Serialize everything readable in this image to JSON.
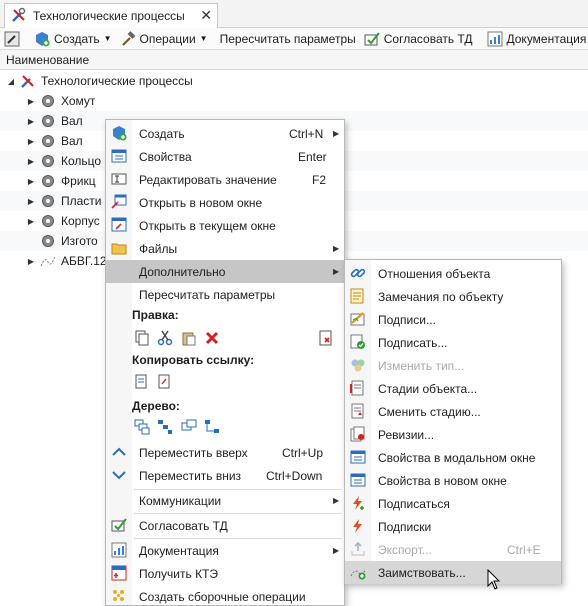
{
  "tab": {
    "title": "Технологические процессы",
    "close": "✕"
  },
  "toolbar": {
    "create": "Создать",
    "operations": "Операции",
    "recalc": "Пересчитать параметры",
    "approve_td": "Согласовать ТД",
    "documentation": "Документация"
  },
  "column_header": "Наименование",
  "tree": {
    "root": "Технологические процессы",
    "items": [
      "Хомут",
      "Вал",
      "Вал",
      "Кольцо",
      "Фрикц",
      "Пласти",
      "Корпус",
      "Изгото",
      "АБВГ.12"
    ]
  },
  "context_menu": {
    "items": [
      {
        "label": "Создать",
        "shortcut": "Ctrl+N",
        "submenu": true
      },
      {
        "label": "Свойства",
        "shortcut": "Enter"
      },
      {
        "label": "Редактировать значение",
        "shortcut": "F2"
      },
      {
        "label": "Открыть в новом окне"
      },
      {
        "label": "Открыть в текущем окне"
      },
      {
        "label": "Файлы",
        "submenu": true
      },
      {
        "label": "Дополнительно",
        "submenu": true
      },
      {
        "label": "Пересчитать параметры"
      }
    ],
    "section_edit": "Правка:",
    "section_copy_link": "Копировать ссылку:",
    "section_tree": "Дерево:",
    "move_up": {
      "label": "Переместить вверх",
      "shortcut": "Ctrl+Up"
    },
    "move_down": {
      "label": "Переместить вниз",
      "shortcut": "Ctrl+Down"
    },
    "communications": "Коммуникации",
    "approve_td": "Согласовать ТД",
    "documentation": "Документация",
    "get_kte": "Получить КТЭ",
    "create_assembly": "Создать сборочные операции"
  },
  "submenu": {
    "items": [
      {
        "label": "Отношения объекта"
      },
      {
        "label": "Замечания по объекту"
      },
      {
        "label": "Подписи..."
      },
      {
        "label": "Подписать..."
      },
      {
        "label": "Изменить тип...",
        "disabled": true
      },
      {
        "label": "Стадии объекта..."
      },
      {
        "label": "Сменить стадию..."
      },
      {
        "label": "Ревизии..."
      },
      {
        "label": "Свойства в модальном окне"
      },
      {
        "label": "Свойства в новом окне"
      },
      {
        "label": "Подписаться"
      },
      {
        "label": "Подписки"
      },
      {
        "label": "Экспорт...",
        "shortcut": "Ctrl+E",
        "disabled": true
      },
      {
        "label": "Заимствовать..."
      }
    ]
  },
  "colors": {
    "highlight": "#c6c6c6",
    "accent_blue": "#2a6ebb",
    "delete_red": "#d42020",
    "disabled": "#a9a9a9"
  }
}
